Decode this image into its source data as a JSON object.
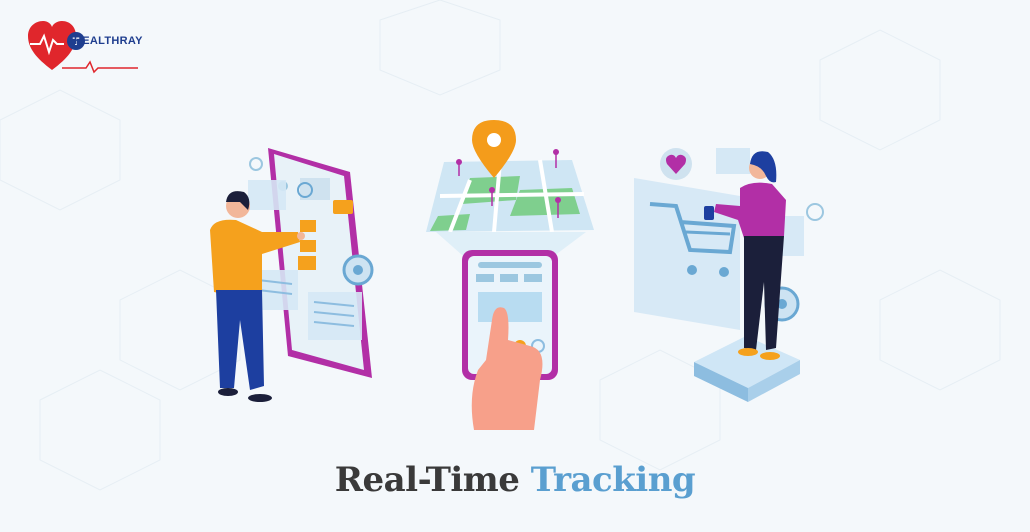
{
  "brand": {
    "name": "HEALTHRAY"
  },
  "caption": {
    "part1": "Real-Time",
    "part2": "Tracking"
  },
  "colors": {
    "background": "#f4f8fb",
    "brand_red": "#e0262c",
    "brand_blue": "#1f3e8f",
    "caption_dark": "#3a3a3a",
    "caption_blue": "#5a9fd0",
    "phone_purple": "#b22fa6",
    "shirt_orange": "#f5a11d",
    "pin_orange": "#f49c1b"
  },
  "icons": {
    "logo": "heart-stethoscope-icon",
    "location_pin": "map-pin-icon",
    "cart": "shopping-cart-icon",
    "heart": "heart-icon"
  }
}
